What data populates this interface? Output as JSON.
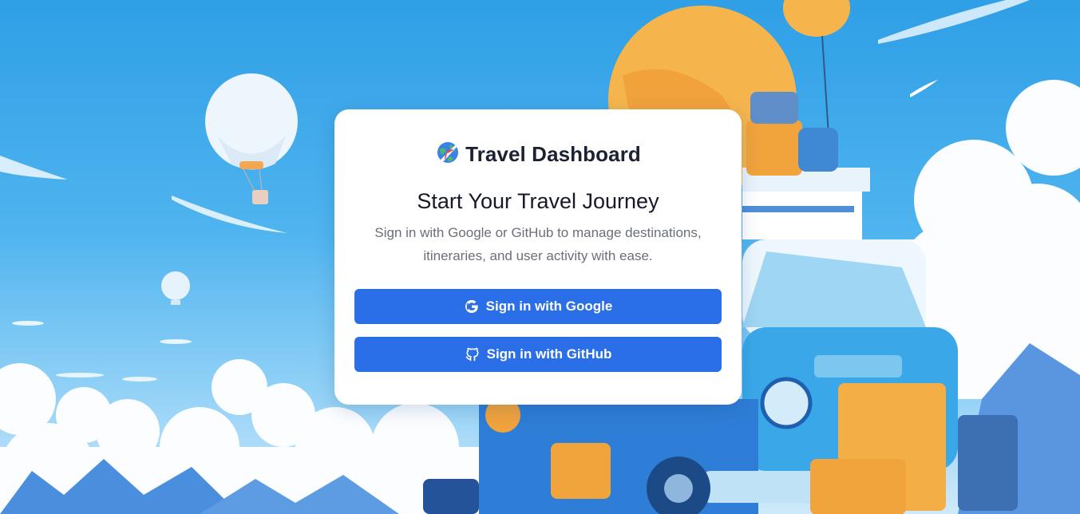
{
  "brand": {
    "title": "Travel Dashboard",
    "icon": "airplane-globe-icon"
  },
  "auth": {
    "heading": "Start Your Travel Journey",
    "description": "Sign in with Google or GitHub to manage destinations, itineraries, and user activity with ease.",
    "google_label": "Sign in with Google",
    "github_label": "Sign in with GitHub",
    "google_icon": "google-icon",
    "github_icon": "github-icon"
  },
  "colors": {
    "primary_button": "#2a6ee8",
    "sky": "#2f9fe6",
    "card": "#ffffff"
  }
}
